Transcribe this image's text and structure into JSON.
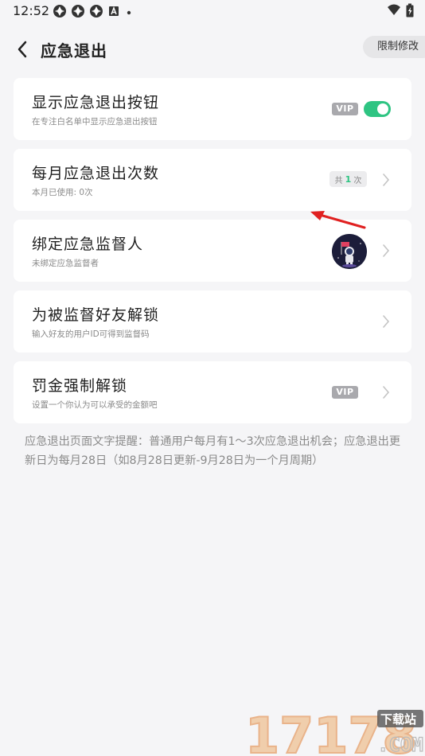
{
  "status_bar": {
    "time": "12:52",
    "left_icons": [
      "app-icon",
      "app-icon",
      "app-icon",
      "a-icon",
      "dot-icon"
    ],
    "right_icons": [
      "wifi-icon",
      "battery-icon"
    ]
  },
  "header": {
    "title": "应急退出",
    "limit_button": "限制修改"
  },
  "cards": [
    {
      "title": "显示应急退出按钮",
      "subtitle": "在专注白名单中显示应急退出按钮",
      "badge": "VIP",
      "toggle_on": true
    },
    {
      "title": "每月应急退出次数",
      "subtitle": "本月已使用: 0次",
      "count_prefix": "共",
      "count_value": "1",
      "count_suffix": "次"
    },
    {
      "title": "绑定应急监督人",
      "subtitle": "未绑定应急监督者"
    },
    {
      "title": "为被监督好友解锁",
      "subtitle": "输入好友的用户ID可得到监督码"
    },
    {
      "title": "罚金强制解锁",
      "subtitle": "设置一个你认为可以承受的金额吧",
      "badge": "VIP"
    }
  ],
  "note": "应急退出页面文字提醒：普通用户每月有1～3次应急退出机会；应急退出更新日为每月28日（如8月28日更新-9月28日为一个月周期）",
  "watermark": {
    "number": "17178",
    "tag": "下载站",
    "domain": ".COM"
  },
  "colors": {
    "background": "#f5f5f7",
    "card": "#ffffff",
    "accent_green": "#2ec482",
    "vip_gray": "#a9a9ad",
    "annotation_red": "#e02020"
  }
}
